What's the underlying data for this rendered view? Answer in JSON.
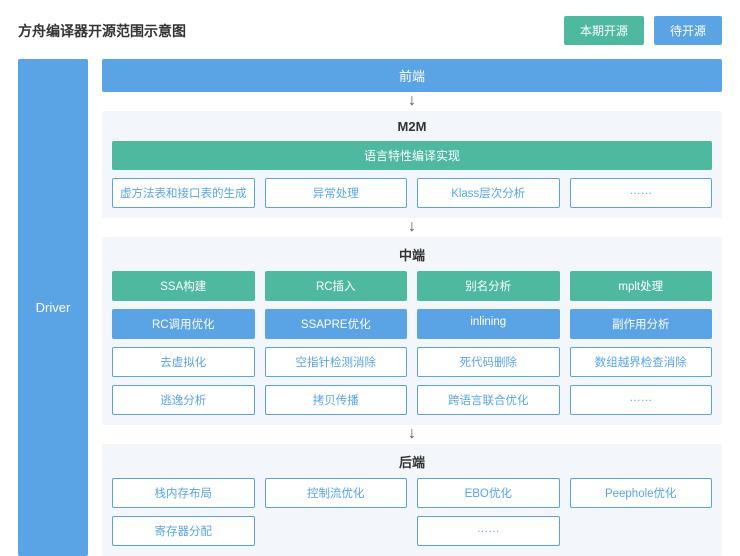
{
  "header": {
    "title": "方舟编译器开源范围示意图",
    "legend": {
      "current": "本期开源",
      "future": "待开源"
    }
  },
  "driver": {
    "label": "Driver"
  },
  "stages": {
    "frontend": "前端",
    "m2m": {
      "title": "M2M",
      "wide": "语言特性编译实现",
      "row1": [
        "虚方法表和接口表的生成",
        "异常处理",
        "Klass层次分析",
        "……"
      ]
    },
    "middle": {
      "title": "中端",
      "row1": [
        "SSA构建",
        "RC插入",
        "别名分析",
        "mplt处理"
      ],
      "row2": [
        "RC调用优化",
        "SSAPRE优化",
        "inlining",
        "副作用分析"
      ],
      "row3": [
        "去虚拟化",
        "空指针检测消除",
        "死代码删除",
        "数组越界检查消除"
      ],
      "row4": [
        "逃逸分析",
        "拷贝传播",
        "跨语言联合优化",
        "……"
      ]
    },
    "backend": {
      "title": "后端",
      "row1": [
        "栈内存布局",
        "控制流优化",
        "EBO优化",
        "Peephole优化"
      ],
      "row2": [
        "寄存器分配",
        "",
        "……",
        ""
      ]
    }
  }
}
